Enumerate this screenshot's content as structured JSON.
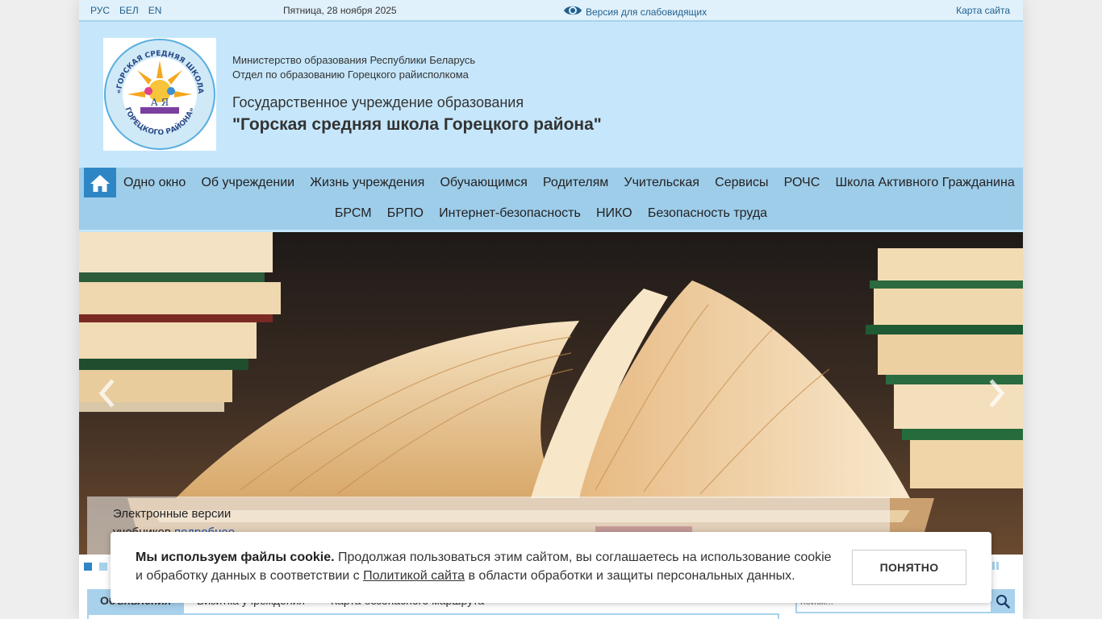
{
  "topbar": {
    "languages": [
      "РУС",
      "БЕЛ",
      "EN"
    ],
    "date": "Пятница, 28 ноября 2025",
    "low_vision_label": "Версия для слабовидящих",
    "sitemap_label": "Карта сайта"
  },
  "header": {
    "ministry_line1": "Министерство образования Республики Беларусь",
    "ministry_line2": "Отдел по образованию Горецкого райисполкома",
    "institution_type": "Государственное учреждение образования",
    "institution_name": "\"Горская средняя школа Горецкого района\"",
    "logo_text": "ГОСУДАРСТВЕННОЕ УЧРЕЖДЕНИЕ ОБРАЗОВАНИЯ «ГОРСКАЯ СРЕДНЯЯ ШКОЛА ГОРЕЦКОГО РАЙОНА»"
  },
  "nav": {
    "home_icon": "home-icon",
    "row1": [
      "Одно окно",
      "Об учреждении",
      "Жизнь учреждения",
      "Обучающимся",
      "Родителям",
      "Учительская",
      "Сервисы",
      "РОЧС",
      "Школа Активного Гражданина"
    ],
    "row2": [
      "БРСМ",
      "БРПО",
      "Интернет-безопасность",
      "НИКО",
      "Безопасность труда"
    ]
  },
  "slider": {
    "caption_text": "Электронные версии учебников",
    "caption_link": "подробнее",
    "dots_count": 2,
    "active_dot": 0
  },
  "tabs": {
    "items": [
      "Объявления",
      "Визитка учреждения",
      "Карта безопасного маршрута"
    ],
    "active": 0
  },
  "search": {
    "placeholder": "поиск..."
  },
  "cookie": {
    "title": "Мы используем файлы cookie.",
    "text_before_link": " Продолжая пользоваться этим сайтом, вы соглашаетесь на использование cookie и обработку данных в соответствии с ",
    "link_text": "Политикой сайта",
    "text_after_link": " в области обработки и защиты персональных данных.",
    "button_label": "ПОНЯТНО"
  },
  "colors": {
    "header_bg": "#c6e7fb",
    "nav_bg": "#9ecdea",
    "accent": "#2f86c4",
    "link": "#1f5f8d"
  }
}
